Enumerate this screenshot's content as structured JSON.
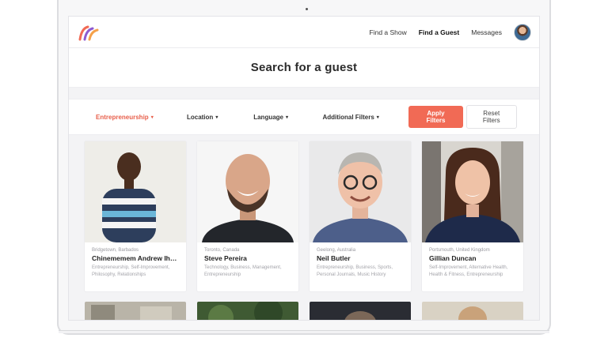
{
  "nav": {
    "links": [
      "Find a Show",
      "Find a Guest",
      "Messages"
    ],
    "active_index": 1
  },
  "page": {
    "title": "Search for a guest"
  },
  "filters": {
    "items": [
      "Entrepreneurship",
      "Location",
      "Language",
      "Additional Filters"
    ],
    "active_index": 0,
    "apply_label": "Apply Filters",
    "reset_label": "Reset Filters"
  },
  "guests": [
    {
      "location": "Bridgetown, Barbados",
      "name": "Chinememem Andrew Ih…",
      "topics": "Entrepreneurship, Self-Improvement, Philosophy, Relationships"
    },
    {
      "location": "Toronto, Canada",
      "name": "Steve Pereira",
      "topics": "Technology, Business, Management, Entrepreneurship"
    },
    {
      "location": "Geelong, Australia",
      "name": "Neil Butler",
      "topics": "Entrepreneurship, Business, Sports, Personal Journals, Music History"
    },
    {
      "location": "Portsmouth, United Kingdom",
      "name": "Gillian Duncan",
      "topics": "Self-Improvement, Alternative Health, Health & Fitness, Entrepreneurship"
    }
  ],
  "colors": {
    "accent": "#f16a55",
    "background": "#f3f3f5"
  }
}
